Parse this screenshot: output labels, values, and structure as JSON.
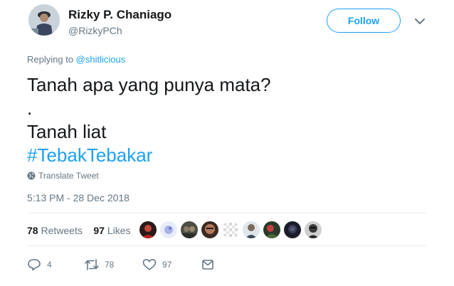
{
  "user": {
    "display_name": "Rizky P. Chaniago",
    "handle": "@RizkyPCh"
  },
  "follow_label": "Follow",
  "reply": {
    "prefix": "Replying to",
    "mention": "@shitlicious"
  },
  "tweet": {
    "line1": "Tanah apa yang punya mata?",
    "line2": ".",
    "line3": "Tanah liat",
    "hashtag": "#TebakTebakar"
  },
  "translate_label": "Translate Tweet",
  "timestamp": "5:13 PM - 28 Dec 2018",
  "stats": {
    "retweets_count": "78",
    "retweets_label": "Retweets",
    "likes_count": "97",
    "likes_label": "Likes"
  },
  "actions": {
    "reply_count": "4",
    "retweet_count": "78",
    "like_count": "97"
  },
  "colors": {
    "accent": "#1da1f2",
    "secondary_text": "#657786",
    "divider": "#e6ecf0"
  },
  "icons": [
    "chevron-down-icon",
    "globe-icon",
    "reply-icon",
    "retweet-icon",
    "heart-icon",
    "message-icon"
  ]
}
